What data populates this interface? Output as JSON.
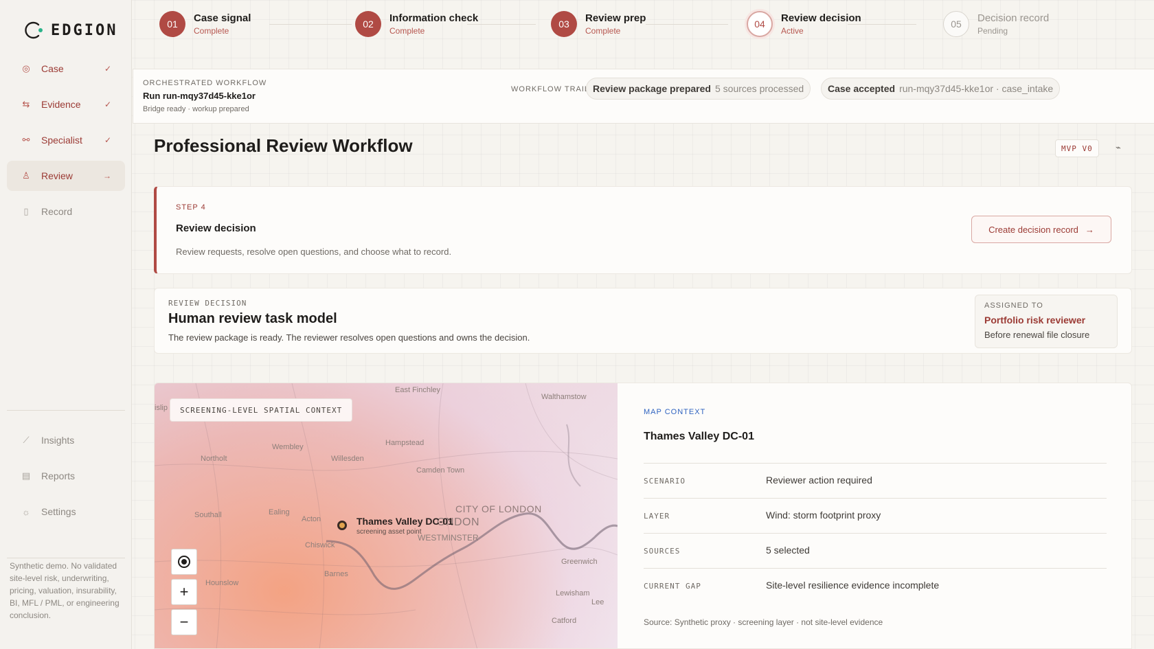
{
  "brand": {
    "name": "EDGION"
  },
  "sidebar": {
    "items": [
      {
        "label": "Case",
        "state": "✓",
        "icon": "target-icon"
      },
      {
        "label": "Evidence",
        "state": "✓",
        "icon": "sliders-icon"
      },
      {
        "label": "Specialist",
        "state": "✓",
        "icon": "share-nodes-icon"
      },
      {
        "label": "Review",
        "state": "→",
        "icon": "user-check-icon"
      },
      {
        "label": "Record",
        "state": "",
        "icon": "document-icon"
      }
    ],
    "secondary": [
      {
        "label": "Insights",
        "icon": "chart-icon"
      },
      {
        "label": "Reports",
        "icon": "report-icon"
      },
      {
        "label": "Settings",
        "icon": "sun-gear-icon"
      }
    ],
    "disclaimer": "Synthetic demo. No validated site-level risk, underwriting, pricing, valuation, insurability, BI, MFL / PML, or engineering conclusion."
  },
  "stepper": [
    {
      "num": "01",
      "title": "Case signal",
      "status": "Complete"
    },
    {
      "num": "02",
      "title": "Information check",
      "status": "Complete"
    },
    {
      "num": "03",
      "title": "Review prep",
      "status": "Complete"
    },
    {
      "num": "04",
      "title": "Review decision",
      "status": "Active"
    },
    {
      "num": "05",
      "title": "Decision record",
      "status": "Pending"
    }
  ],
  "workflow": {
    "label": "ORCHESTRATED WORKFLOW",
    "run": "Run run-mqy37d45-kke1or",
    "sub": "Bridge ready · workup prepared",
    "trail_label": "WORKFLOW TRAIL",
    "trail": [
      {
        "bold": "Review package prepared",
        "light": "5 sources processed"
      },
      {
        "bold": "Case accepted",
        "light": "run-mqy37d45-kke1or · case_intake"
      }
    ]
  },
  "page": {
    "title": "Professional Review Workflow",
    "badge": "MVP V0",
    "collapse_glyph": "⌁"
  },
  "step_card": {
    "kicker": "STEP 4",
    "title": "Review decision",
    "desc": "Review requests, resolve open questions, and choose what to record.",
    "button": "Create decision record",
    "button_arrow": "→"
  },
  "task_card": {
    "kicker": "REVIEW DECISION",
    "title": "Human review task model",
    "desc": "The review package is ready. The reviewer resolves open questions and owns the decision.",
    "assigned_label": "ASSIGNED TO",
    "assigned_name": "Portfolio risk reviewer",
    "assigned_sub": "Before renewal file closure"
  },
  "map": {
    "badge": "SCREENING-LEVEL SPATIAL CONTEXT",
    "pin_label": "Thames Valley DC-01",
    "pin_sub": "screening asset point",
    "places": [
      "East Finchley",
      "Walthamstow",
      "Hampstead",
      "Wembley",
      "Northolt",
      "Willesden",
      "Camden Town",
      "CITY OF LONDON",
      "ONDON",
      "Southall",
      "Ealing",
      "Acton",
      "WESTMINSTER",
      "Chiswick",
      "Hounslow",
      "Barnes",
      "Greenwich",
      "Lewisham",
      "Lee",
      "Catford",
      "islip"
    ],
    "controls": {
      "zoom_in": "+",
      "zoom_out": "−"
    }
  },
  "context": {
    "kicker": "MAP CONTEXT",
    "title": "Thames Valley DC-01",
    "rows": [
      {
        "k": "SCENARIO",
        "v": "Reviewer action required"
      },
      {
        "k": "LAYER",
        "v": "Wind: storm footprint proxy"
      },
      {
        "k": "SOURCES",
        "v": "5 selected"
      },
      {
        "k": "CURRENT GAP",
        "v": "Site-level resilience evidence incomplete"
      }
    ],
    "source_note": "Source: Synthetic proxy · screening layer · not site-level evidence"
  },
  "colors": {
    "accent": "#b04a44",
    "link": "#2f63c0"
  }
}
